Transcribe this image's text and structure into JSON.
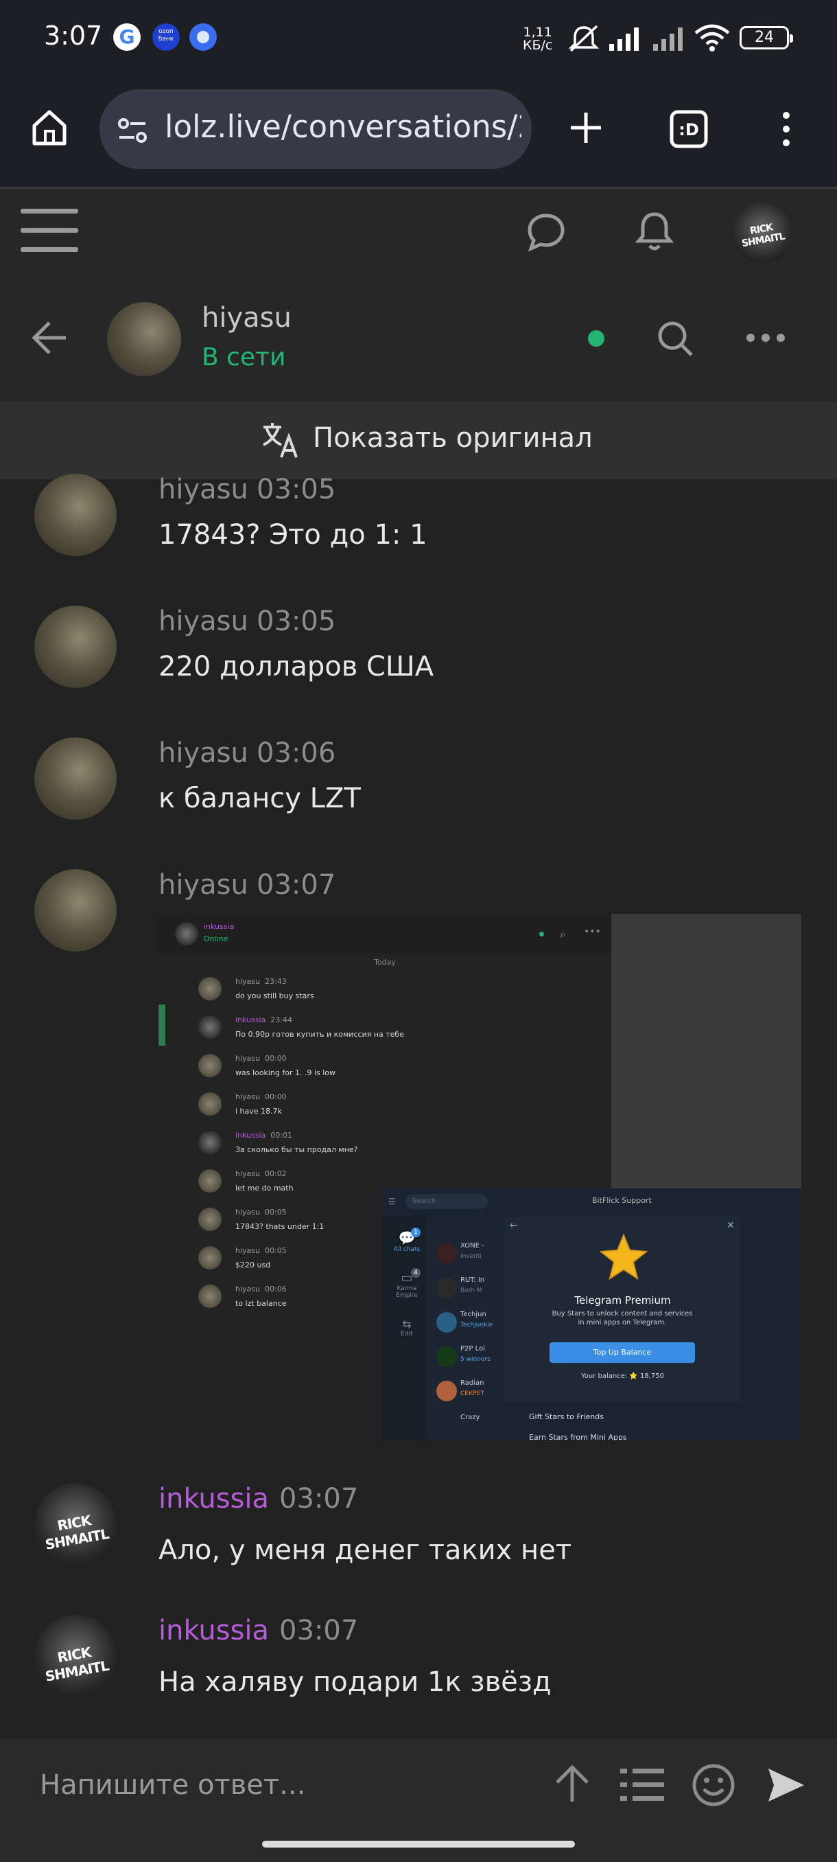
{
  "status_bar": {
    "time": "3:07",
    "net_speed_value": "1,11",
    "net_speed_unit": "КБ/с",
    "battery": "24",
    "ozon_label": "ozon банк"
  },
  "browser": {
    "url": "lolz.live/conversations/2"
  },
  "conversation": {
    "partner_name": "hiyasu",
    "partner_status": "В сети",
    "online_color": "#22b573",
    "translate_label": "Показать оригинал"
  },
  "messages": [
    {
      "author": "hiyasu",
      "time": "03:05",
      "text": "17843? Это до 1: 1"
    },
    {
      "author": "hiyasu",
      "time": "03:05",
      "text": "220 долларов США"
    },
    {
      "author": "hiyasu",
      "time": "03:06",
      "text": "к балансу LZT"
    },
    {
      "author": "hiyasu",
      "time": "03:07",
      "text": ""
    },
    {
      "author": "inkussia",
      "time": "03:07",
      "text": "Ало, у меня денег таких нет"
    },
    {
      "author": "inkussia",
      "time": "03:07",
      "text": "На халяву подари 1к звёзд"
    }
  ],
  "attachment": {
    "header_name": "inkussia",
    "header_status": "Online",
    "day_label": "Today",
    "chat": [
      {
        "author": "hiyasu",
        "time": "23:43",
        "text": "do you still buy stars"
      },
      {
        "author": "inkussia",
        "time": "23:44",
        "text": "По 0.90р готов купить и комиссия на тебе"
      },
      {
        "author": "hiyasu",
        "time": "00:00",
        "text": "was looking for 1. .9 is low"
      },
      {
        "author": "hiyasu",
        "time": "00:00",
        "text": "i have 18.7k"
      },
      {
        "author": "inkussia",
        "time": "00:01",
        "text": "За сколько бы ты продал мне?"
      },
      {
        "author": "hiyasu",
        "time": "00:02",
        "text": "let me do math"
      },
      {
        "author": "hiyasu",
        "time": "00:05",
        "text": "17843? thats under 1:1"
      },
      {
        "author": "hiyasu",
        "time": "00:05",
        "text": "$220 usd"
      },
      {
        "author": "hiyasu",
        "time": "00:06",
        "text": "to lzt balance"
      }
    ],
    "telegram": {
      "search_placeholder": "Search",
      "support_label": "BitFlick Support",
      "all_chats": "All chats",
      "all_chats_badge": "1",
      "karma_label": "Karma Empire",
      "karma_badge": "4",
      "edit_label": "Edit",
      "side_chats": [
        "XONE -",
        "RUT: In",
        "Techjun",
        "P2P Lol",
        "Radian",
        "Crazy"
      ],
      "side_sub": [
        "Inventi",
        "Both M",
        "Techjunkie",
        "5 winners",
        "СЕКРЕТ",
        ""
      ],
      "popup_title": "Telegram Premium",
      "popup_desc": "Buy Stars to unlock content and services in mini apps on Telegram.",
      "popup_button": "Top Up Balance",
      "popup_balance": "Your balance: ⭐ 18,750",
      "gift_label": "Gift Stars to Friends",
      "earn_label": "Earn Stars from Mini Apps"
    }
  },
  "composer": {
    "placeholder": "Напишите ответ..."
  },
  "avatar_art_text": "RICK SHMAITL"
}
